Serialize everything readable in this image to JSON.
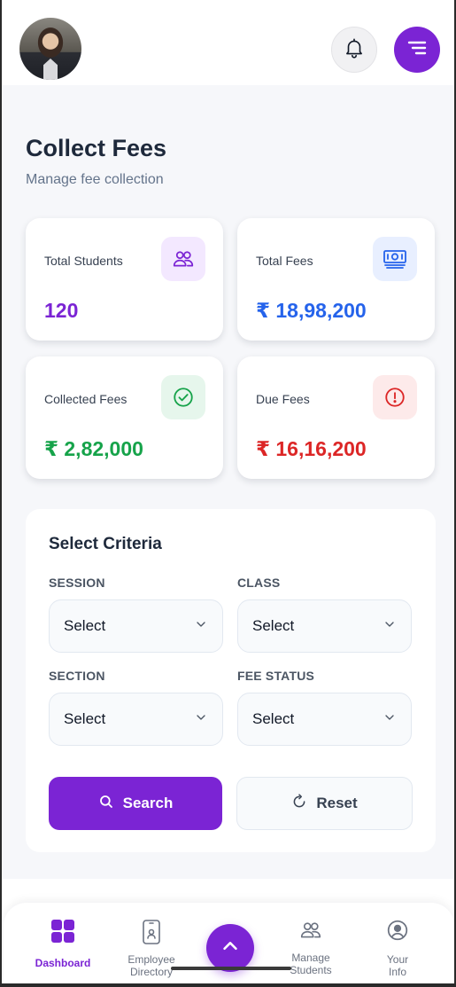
{
  "header": {
    "avatar_icon": "user-avatar",
    "notification_icon": "bell-icon",
    "menu_icon": "menu-lines-icon"
  },
  "page": {
    "title": "Collect Fees",
    "subtitle": "Manage fee collection"
  },
  "stats": [
    {
      "label": "Total Students",
      "value": "120",
      "icon": "users-icon",
      "color": "#7b24d4",
      "icon_bg": "#f3e8ff"
    },
    {
      "label": "Total Fees",
      "value": "₹ 18,98,200",
      "icon": "banknote-icon",
      "color": "#2563eb",
      "icon_bg": "#e8efff"
    },
    {
      "label": "Collected Fees",
      "value": "₹ 2,82,000",
      "icon": "check-circle-icon",
      "color": "#16a34a",
      "icon_bg": "#e6f6ec"
    },
    {
      "label": "Due Fees",
      "value": "₹ 16,16,200",
      "icon": "alert-circle-icon",
      "color": "#dc2626",
      "icon_bg": "#fdeaea"
    }
  ],
  "criteria": {
    "title": "Select Criteria",
    "session": {
      "label": "SESSION",
      "value": "Select"
    },
    "class": {
      "label": "CLASS",
      "value": "Select"
    },
    "section": {
      "label": "SECTION",
      "value": "Select"
    },
    "fee_status": {
      "label": "FEE STATUS",
      "value": "Select"
    },
    "search_label": "Search",
    "reset_label": "Reset"
  },
  "bottom_nav": {
    "items": [
      {
        "label": "Dashboard",
        "icon": "grid-icon",
        "active": true
      },
      {
        "label": "Employee\nDirectory",
        "icon": "id-badge-icon",
        "active": false
      },
      {
        "label": "Manage\nStudents",
        "icon": "users-icon",
        "active": false
      },
      {
        "label": "Your\nInfo",
        "icon": "user-circle-icon",
        "active": false
      }
    ],
    "fab_icon": "chevron-up-icon"
  },
  "colors": {
    "primary": "#7b24d4",
    "background": "#f6f7fa"
  }
}
